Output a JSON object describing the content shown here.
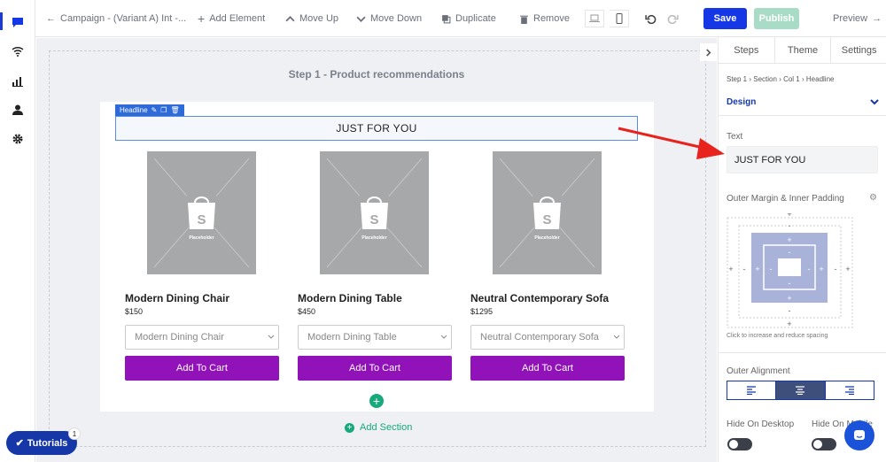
{
  "toolbar": {
    "back_label": "Campaign - (Variant A) Int -...",
    "add_element": "Add Element",
    "move_up": "Move Up",
    "move_down": "Move Down",
    "duplicate": "Duplicate",
    "remove": "Remove",
    "save": "Save",
    "publish": "Publish",
    "preview": "Preview"
  },
  "canvas": {
    "step_title": "Step 1 - Product recommendations",
    "headline_tag": "Headline",
    "headline_text": "JUST FOR YOU",
    "placeholder_label": "Placeholder",
    "products": [
      {
        "name": "Modern Dining Chair",
        "price": "$150",
        "select": "Modern Dining Chair",
        "button": "Add To Cart"
      },
      {
        "name": "Modern Dining Table",
        "price": "$450",
        "select": "Modern Dining Table",
        "button": "Add To Cart"
      },
      {
        "name": "Neutral Contemporary Sofa",
        "price": "$1295",
        "select": "Neutral Contemporary Sofa",
        "button": "Add To Cart"
      }
    ],
    "add_section": "Add Section"
  },
  "tutorials": {
    "label": "Tutorials",
    "badge": "1"
  },
  "right_panel": {
    "tabs": [
      "Steps",
      "Theme",
      "Settings"
    ],
    "breadcrumb": [
      "Step 1",
      "Section",
      "Col 1",
      "Headline"
    ],
    "design_label": "Design",
    "text_label": "Text",
    "text_value": "JUST FOR YOU",
    "spacing_label": "Outer Margin & Inner Padding",
    "spacing_hint": "Click to increase and reduce spacing",
    "alignment_label": "Outer Alignment",
    "hide_desktop": "Hide On Desktop",
    "hide_mobile": "Hide On Mobile"
  },
  "colors": {
    "accent": "#1537e6",
    "publish": "#a8dcc6",
    "cart_button": "#9012b8",
    "add_green": "#16a97b",
    "annotation_arrow": "#e8231e"
  }
}
